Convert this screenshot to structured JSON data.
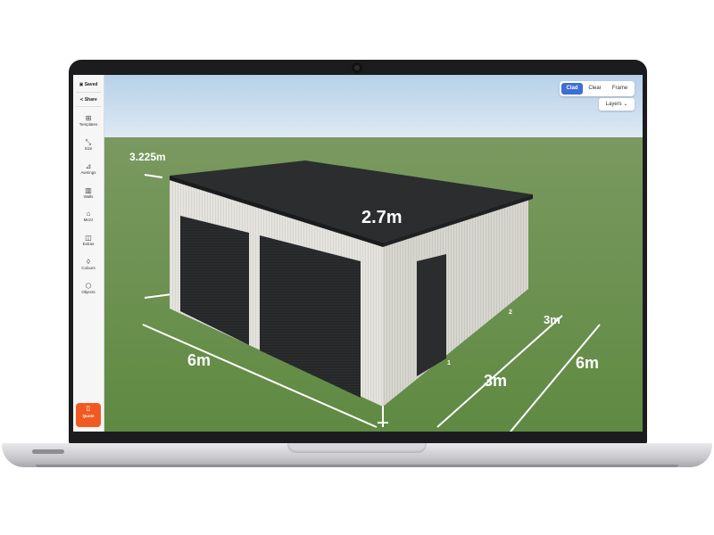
{
  "sidebar": {
    "saved": "Saved",
    "share": "Share",
    "items": [
      {
        "icon": "grid-icon",
        "label": "Templates"
      },
      {
        "icon": "resize-icon",
        "label": "Size"
      },
      {
        "icon": "awning-icon",
        "label": "Awnings"
      },
      {
        "icon": "walls-icon",
        "label": "Walls"
      },
      {
        "icon": "mezz-icon",
        "label": "Mezz"
      },
      {
        "icon": "extras-icon",
        "label": "Extras"
      },
      {
        "icon": "droplet-icon",
        "label": "Colours"
      },
      {
        "icon": "cube-icon",
        "label": "Objects"
      }
    ],
    "quote": "Quote"
  },
  "view_toggle": {
    "options": [
      "Clad",
      "Clear",
      "Frame"
    ],
    "active": "Clad"
  },
  "layers_label": "Layers",
  "dimensions": {
    "awning_left": "3.225m",
    "height": "2.7m",
    "front_length": "6m",
    "side_segment_1": "3m",
    "side_segment_2": "3m",
    "side_total": "6m",
    "bay_1": "1",
    "bay_2": "2"
  },
  "colors": {
    "accent": "#3b6fd6",
    "quote_button": "#f05a22",
    "roof": "#2b2d2f",
    "walls": "#e2e1dc",
    "grass": "#6b8e4e",
    "sky": "#c7dbec"
  }
}
